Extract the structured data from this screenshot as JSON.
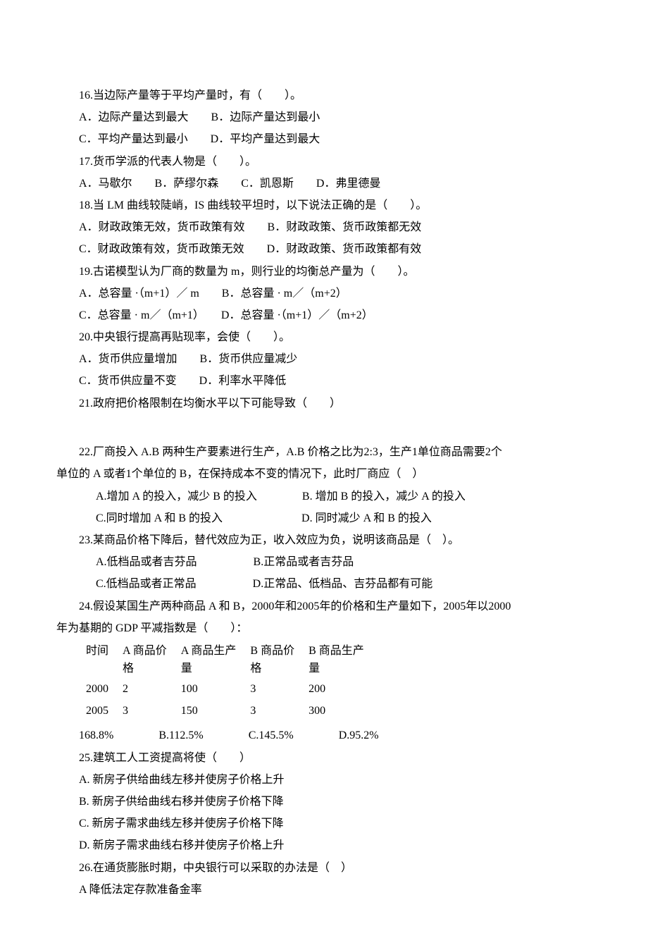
{
  "q16": {
    "stem": "16.当边际产量等于平均产量时，有（　　）。",
    "a": "A．边际产量达到最大　　B．边际产量达到最小",
    "b": "C．平均产量达到最小　　D．平均产量达到最大"
  },
  "q17": {
    "stem": "17.货币学派的代表人物是（　　）。",
    "a": "A．马歇尔　　B．萨缪尔森　　C．凯恩斯　　D．弗里德曼"
  },
  "q18": {
    "stem": "18.当 LM 曲线较陡峭，IS 曲线较平坦时，以下说法正确的是（　　）。",
    "a": "A．财政政策无效，货币政策有效　　B．财政政策、货币政策都无效",
    "b": "C．财政政策有效，货币政策无效　　D．财政政策、货币政策都有效"
  },
  "q19": {
    "stem": "19.古诺模型认为厂商的数量为 m，则行业的均衡总产量为（　　）。",
    "a": "A．总容量 ·（m+1）／ m　　B．总容量 · m／（m+2）",
    "b": "C．总容量 · m／（m+1）　　D．总容量 ·（m+1）／（m+2）"
  },
  "q20": {
    "stem": "20.中央银行提高再贴现率，会使（　　）。",
    "a": "A．货币供应量增加　　B．货币供应量减少",
    "b": "C．货币供应量不变　　D．利率水平降低"
  },
  "q21": {
    "stem": "21.政府把价格限制在均衡水平以下可能导致（　　）"
  },
  "q22": {
    "stem1": "22.厂商投入 A.B 两种生产要素进行生产，A.B 价格之比为2:3，生产1单位商品需要2个",
    "stem2": "单位的 A 或者1个单位的 B，在保持成本不变的情况下，此时厂商应（　）",
    "a": "A.增加 A 的投入，减少 B 的投入　　　　B. 增加 B 的投入，减少 A 的投入",
    "b": "C.同时增加 A 和 B 的投入　　　　　　　D. 同时减少 A 和 B 的投入"
  },
  "q23": {
    "stem": "23.某商品价格下降后，替代效应为正，收入效应为负，说明该商品是（　）。",
    "a": "A.低档品或者吉芬品　　　　　B.正常品或者吉芬品",
    "b": "C.低档品或者正常品　　　　　D.正常品、低档品、吉芬品都有可能"
  },
  "q24": {
    "stem1": "24.假设某国生产两种商品 A 和 B，2000年和2005年的价格和生产量如下，2005年以2000",
    "stem2": "年为基期的 GDP 平减指数是（　　）：",
    "headers": {
      "time": "时间",
      "pa": "A 商品价格",
      "qa": "A 商品生产量",
      "pb": "B 商品价格",
      "qb": "B 商品生产量"
    },
    "row1": {
      "time": "2000",
      "pa": "2",
      "qa": "100",
      "pb": "3",
      "qb": "200"
    },
    "row2": {
      "time": "2005",
      "pa": "3",
      "qa": "150",
      "pb": "3",
      "qb": "300"
    },
    "options": "168.8%　　　　B.112.5%　　　　C.145.5%　　　　D.95.2%"
  },
  "q25": {
    "stem": "25.建筑工人工资提高将使（　　）",
    "a": "A. 新房子供给曲线左移并使房子价格上升",
    "b": "B. 新房子供给曲线右移并使房子价格下降",
    "c": "C. 新房子需求曲线左移并使房子价格下降",
    "d": "D. 新房子需求曲线右移并使房子价格上升"
  },
  "q26": {
    "stem": "26.在通货膨胀时期，中央银行可以采取的办法是（　）",
    "a": "A 降低法定存款准备金率"
  }
}
